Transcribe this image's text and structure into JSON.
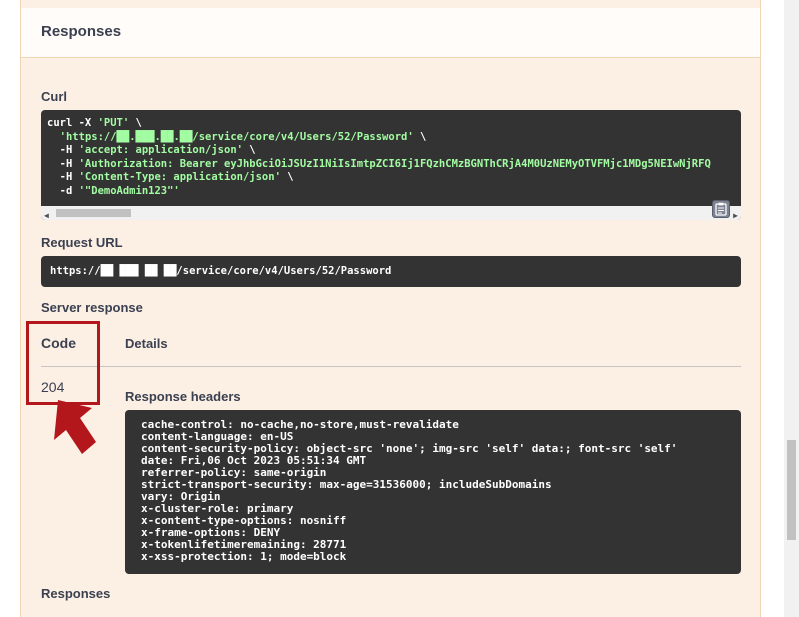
{
  "responses_header": {
    "title": "Responses"
  },
  "curl": {
    "label": "Curl",
    "lines": [
      {
        "pre": "curl -X ",
        "str": "'PUT'",
        "post": " \\"
      },
      {
        "pre": "  ",
        "str": "'https://██.███.██.██/service/core/v4/Users/52/Password'",
        "post": " \\"
      },
      {
        "pre": "  -H ",
        "str": "'accept: application/json'",
        "post": " \\"
      },
      {
        "pre": "  -H ",
        "str": "'Authorization: Bearer eyJhbGciOiJSUzI1NiIsImtpZCI6Ij1FQzhCMzBGNThCRjA4M0UzNEMyOTVFMjc1MDg5NEIwNjRFQ",
        "post": ""
      },
      {
        "pre": "  -H ",
        "str": "'Content-Type: application/json'",
        "post": " \\"
      },
      {
        "pre": "  -d ",
        "str": "'\"DemoAdmin123\"'",
        "post": ""
      }
    ]
  },
  "request_url": {
    "label": "Request URL",
    "value": "https://██ ███ ██ ██/service/core/v4/Users/52/Password"
  },
  "server_response": {
    "label": "Server response",
    "code_header": "Code",
    "details_header": "Details",
    "code_value": "204",
    "response_headers_label": "Response headers",
    "response_headers": "cache-control: no-cache,no-store,must-revalidate\ncontent-language: en-US\ncontent-security-policy: object-src 'none'; img-src 'self' data:; font-src 'self'\ndate: Fri,06 Oct 2023 05:51:34 GMT\nreferrer-policy: same-origin\nstrict-transport-security: max-age=31536000; includeSubDomains\nvary: Origin\nx-cluster-role: primary\nx-content-type-options: nosniff\nx-frame-options: DENY\nx-tokenlifetimeremaining: 28771\nx-xss-protection: 1; mode=block"
  },
  "responses_footer": {
    "label": "Responses"
  },
  "colors": {
    "panel_bg": "#fcefe4",
    "code_bg": "#333333",
    "string_green": "#a2fca2",
    "highlight_red": "#b3161b"
  },
  "icons": {
    "copy": "clipboard-icon",
    "annotation": "arrow-up-icon"
  }
}
